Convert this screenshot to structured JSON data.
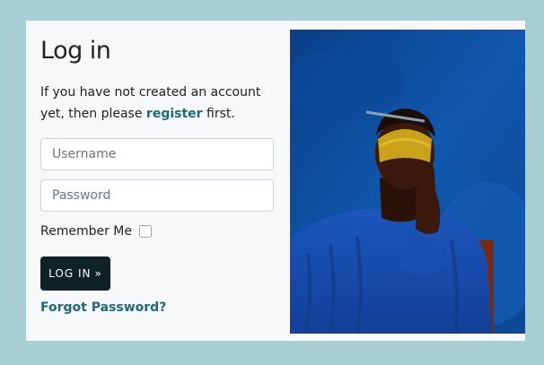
{
  "login": {
    "title": "Log in",
    "intro_prefix": "If you have not created an account yet, then please ",
    "register_link": "register",
    "intro_suffix": " first.",
    "username_placeholder": "Username",
    "password_placeholder": "Password",
    "remember_label": "Remember Me",
    "remember_checked": false,
    "submit_label": "LOG IN",
    "submit_icon": "double-chevron-right-icon",
    "forgot_link": "Forgot Password?"
  },
  "colors": {
    "page_background": "#a8cdd2",
    "card_background": "#f6f8fa",
    "accent_link": "#1e6b73",
    "button": "#0f2327"
  }
}
